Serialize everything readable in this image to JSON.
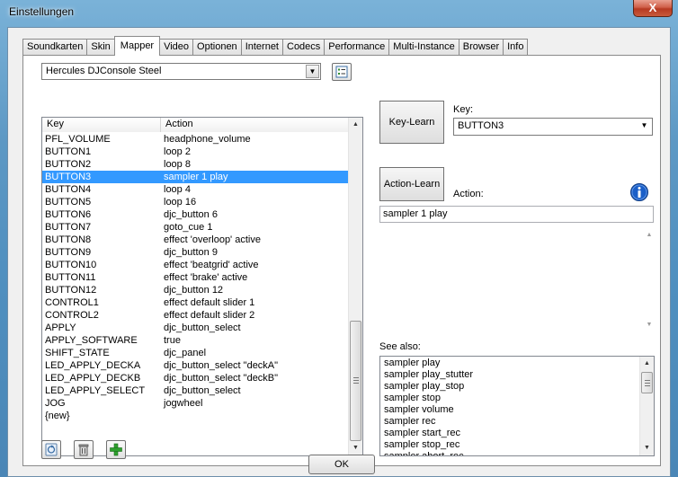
{
  "window": {
    "title": "Einstellungen",
    "close_label": "X"
  },
  "tabs": [
    {
      "label": "Soundkarten",
      "active": false
    },
    {
      "label": "Skin",
      "active": false
    },
    {
      "label": "Mapper",
      "active": true
    },
    {
      "label": "Video",
      "active": false
    },
    {
      "label": "Optionen",
      "active": false
    },
    {
      "label": "Internet",
      "active": false
    },
    {
      "label": "Codecs",
      "active": false
    },
    {
      "label": "Performance",
      "active": false
    },
    {
      "label": "Multi-Instance",
      "active": false
    },
    {
      "label": "Browser",
      "active": false
    },
    {
      "label": "Info",
      "active": false
    }
  ],
  "device": {
    "selected": "Hercules DJConsole Steel"
  },
  "mapping_table": {
    "columns": [
      "Key",
      "Action"
    ],
    "rows": [
      {
        "key": "PFL_VOLUME",
        "action": "headphone_volume"
      },
      {
        "key": "BUTTON1",
        "action": "loop 2"
      },
      {
        "key": "BUTTON2",
        "action": "loop 8"
      },
      {
        "key": "BUTTON3",
        "action": "sampler 1 play",
        "selected": true
      },
      {
        "key": "BUTTON4",
        "action": "loop 4"
      },
      {
        "key": "BUTTON5",
        "action": "loop 16"
      },
      {
        "key": "BUTTON6",
        "action": "djc_button 6"
      },
      {
        "key": "BUTTON7",
        "action": "goto_cue 1"
      },
      {
        "key": "BUTTON8",
        "action": "effect 'overloop' active"
      },
      {
        "key": "BUTTON9",
        "action": "djc_button 9"
      },
      {
        "key": "BUTTON10",
        "action": "effect 'beatgrid' active"
      },
      {
        "key": "BUTTON11",
        "action": "effect 'brake' active"
      },
      {
        "key": "BUTTON12",
        "action": "djc_button 12"
      },
      {
        "key": "CONTROL1",
        "action": "effect default slider 1"
      },
      {
        "key": "CONTROL2",
        "action": "effect default slider 2"
      },
      {
        "key": "APPLY",
        "action": "djc_button_select"
      },
      {
        "key": "APPLY_SOFTWARE",
        "action": "true"
      },
      {
        "key": "SHIFT_STATE",
        "action": "djc_panel"
      },
      {
        "key": "LED_APPLY_DECKA",
        "action": "djc_button_select \"deckA\""
      },
      {
        "key": "LED_APPLY_DECKB",
        "action": "djc_button_select \"deckB\""
      },
      {
        "key": "LED_APPLY_SELECT",
        "action": "djc_button_select"
      },
      {
        "key": "JOG",
        "action": "jogwheel"
      },
      {
        "key": "{new}",
        "action": ""
      }
    ]
  },
  "key_learn": {
    "button_label": "Key-Learn",
    "key_label": "Key:",
    "key_value": "BUTTON3"
  },
  "action_learn": {
    "button_label": "Action-Learn",
    "action_label": "Action:",
    "action_value": "sampler 1 play"
  },
  "see_also": {
    "label": "See also:",
    "items": [
      "sampler play",
      "sampler play_stutter",
      "sampler play_stop",
      "sampler stop",
      "sampler volume",
      "sampler rec",
      "sampler start_rec",
      "sampler stop_rec",
      "sampler abort_rec"
    ]
  },
  "footer": {
    "ok_label": "OK"
  },
  "icons": {
    "list_view_toggle": "list-view-icon",
    "info": "info-icon",
    "load_file": "load-mapping-icon",
    "delete": "trash-icon",
    "add": "plus-icon"
  },
  "colors": {
    "selection": "#3399ff",
    "add_green": "#2ea02e",
    "info_blue": "#1a5fc8"
  }
}
